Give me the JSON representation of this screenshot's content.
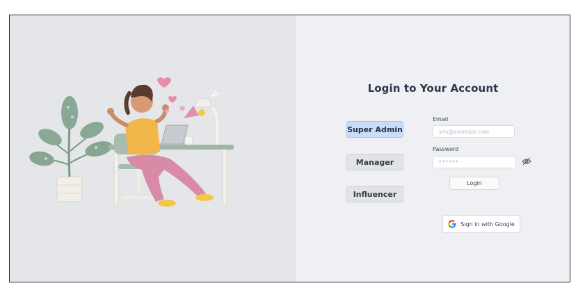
{
  "login": {
    "title": "Login to Your Account",
    "roles": [
      "Super Admin",
      "Manager",
      "Influencer"
    ],
    "active_role": "Super Admin",
    "email_label": "Email",
    "email_placeholder": "you@example.com",
    "password_label": "Password",
    "password_value": "******",
    "login_button": "Login",
    "google_button": "Sign in with Google"
  },
  "colors": {
    "left_panel_bg": "#e4e6e9",
    "right_panel_bg": "#eef0f3",
    "active_role_bg": "#c9dcf8",
    "inactive_role_bg": "#e1e3e6",
    "title_color": "#2d3748"
  },
  "icons": [
    "eye-slash-icon",
    "google-g-icon"
  ]
}
